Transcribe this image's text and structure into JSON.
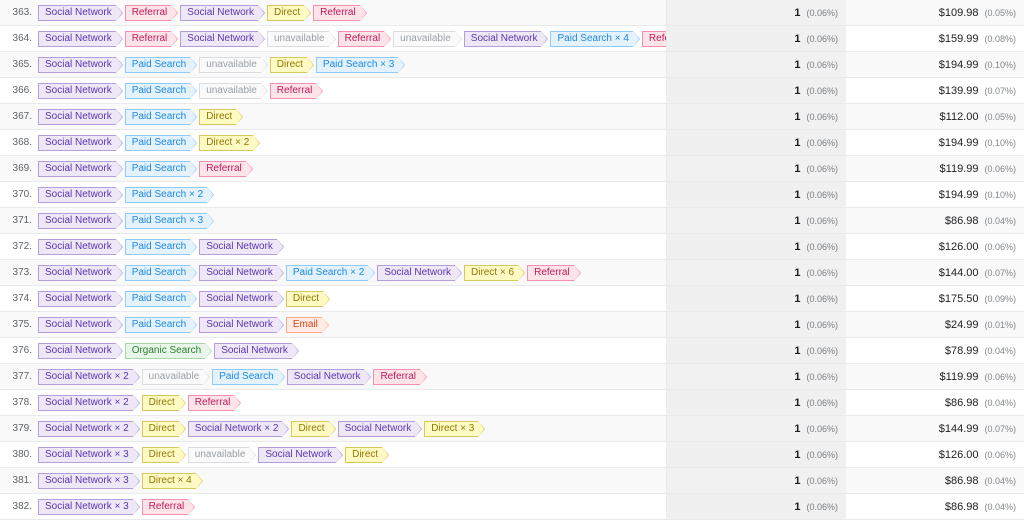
{
  "labels": {
    "social": "Social Network",
    "paid": "Paid Search",
    "direct": "Direct",
    "referral": "Referral",
    "unavail": "unavailable",
    "organic": "Organic Search",
    "email": "Email"
  },
  "count_value": "1",
  "count_pct": "(0.06%)",
  "rows": [
    {
      "idx": "363.",
      "value": "$109.98",
      "vpct": "(0.05%)",
      "path": [
        {
          "t": "social"
        },
        {
          "t": "referral"
        },
        {
          "t": "social"
        },
        {
          "t": "direct"
        },
        {
          "t": "referral"
        }
      ]
    },
    {
      "idx": "364.",
      "value": "$159.99",
      "vpct": "(0.08%)",
      "path": [
        {
          "t": "social"
        },
        {
          "t": "referral"
        },
        {
          "t": "social"
        },
        {
          "t": "unavail"
        },
        {
          "t": "referral"
        },
        {
          "t": "unavail"
        },
        {
          "t": "social"
        },
        {
          "t": "paid",
          "x": 4
        },
        {
          "t": "referral"
        }
      ]
    },
    {
      "idx": "365.",
      "value": "$194.99",
      "vpct": "(0.10%)",
      "path": [
        {
          "t": "social"
        },
        {
          "t": "paid"
        },
        {
          "t": "unavail"
        },
        {
          "t": "direct"
        },
        {
          "t": "paid",
          "x": 3
        }
      ]
    },
    {
      "idx": "366.",
      "value": "$139.99",
      "vpct": "(0.07%)",
      "path": [
        {
          "t": "social"
        },
        {
          "t": "paid"
        },
        {
          "t": "unavail"
        },
        {
          "t": "referral"
        }
      ]
    },
    {
      "idx": "367.",
      "value": "$112.00",
      "vpct": "(0.05%)",
      "path": [
        {
          "t": "social"
        },
        {
          "t": "paid"
        },
        {
          "t": "direct"
        }
      ]
    },
    {
      "idx": "368.",
      "value": "$194.99",
      "vpct": "(0.10%)",
      "path": [
        {
          "t": "social"
        },
        {
          "t": "paid"
        },
        {
          "t": "direct",
          "x": 2
        }
      ]
    },
    {
      "idx": "369.",
      "value": "$119.99",
      "vpct": "(0.06%)",
      "path": [
        {
          "t": "social"
        },
        {
          "t": "paid"
        },
        {
          "t": "referral"
        }
      ]
    },
    {
      "idx": "370.",
      "value": "$194.99",
      "vpct": "(0.10%)",
      "path": [
        {
          "t": "social"
        },
        {
          "t": "paid",
          "x": 2
        }
      ]
    },
    {
      "idx": "371.",
      "value": "$86.98",
      "vpct": "(0.04%)",
      "path": [
        {
          "t": "social"
        },
        {
          "t": "paid",
          "x": 3
        }
      ]
    },
    {
      "idx": "372.",
      "value": "$126.00",
      "vpct": "(0.06%)",
      "path": [
        {
          "t": "social"
        },
        {
          "t": "paid"
        },
        {
          "t": "social"
        }
      ]
    },
    {
      "idx": "373.",
      "value": "$144.00",
      "vpct": "(0.07%)",
      "path": [
        {
          "t": "social"
        },
        {
          "t": "paid"
        },
        {
          "t": "social"
        },
        {
          "t": "paid",
          "x": 2
        },
        {
          "t": "social"
        },
        {
          "t": "direct",
          "x": 6
        },
        {
          "t": "referral"
        }
      ]
    },
    {
      "idx": "374.",
      "value": "$175.50",
      "vpct": "(0.09%)",
      "path": [
        {
          "t": "social"
        },
        {
          "t": "paid"
        },
        {
          "t": "social"
        },
        {
          "t": "direct"
        }
      ]
    },
    {
      "idx": "375.",
      "value": "$24.99",
      "vpct": "(0.01%)",
      "path": [
        {
          "t": "social"
        },
        {
          "t": "paid"
        },
        {
          "t": "social"
        },
        {
          "t": "email"
        }
      ]
    },
    {
      "idx": "376.",
      "value": "$78.99",
      "vpct": "(0.04%)",
      "path": [
        {
          "t": "social"
        },
        {
          "t": "organic"
        },
        {
          "t": "social"
        }
      ]
    },
    {
      "idx": "377.",
      "value": "$119.99",
      "vpct": "(0.06%)",
      "path": [
        {
          "t": "social",
          "x": 2
        },
        {
          "t": "unavail"
        },
        {
          "t": "paid"
        },
        {
          "t": "social"
        },
        {
          "t": "referral"
        }
      ]
    },
    {
      "idx": "378.",
      "value": "$86.98",
      "vpct": "(0.04%)",
      "path": [
        {
          "t": "social",
          "x": 2
        },
        {
          "t": "direct"
        },
        {
          "t": "referral"
        }
      ]
    },
    {
      "idx": "379.",
      "value": "$144.99",
      "vpct": "(0.07%)",
      "path": [
        {
          "t": "social",
          "x": 2
        },
        {
          "t": "direct"
        },
        {
          "t": "social",
          "x": 2
        },
        {
          "t": "direct"
        },
        {
          "t": "social"
        },
        {
          "t": "direct",
          "x": 3
        }
      ]
    },
    {
      "idx": "380.",
      "value": "$126.00",
      "vpct": "(0.06%)",
      "path": [
        {
          "t": "social",
          "x": 3
        },
        {
          "t": "direct"
        },
        {
          "t": "unavail"
        },
        {
          "t": "social"
        },
        {
          "t": "direct"
        }
      ]
    },
    {
      "idx": "381.",
      "value": "$86.98",
      "vpct": "(0.04%)",
      "path": [
        {
          "t": "social",
          "x": 3
        },
        {
          "t": "direct",
          "x": 4
        }
      ]
    },
    {
      "idx": "382.",
      "value": "$86.98",
      "vpct": "(0.04%)",
      "path": [
        {
          "t": "social",
          "x": 3
        },
        {
          "t": "referral"
        }
      ]
    }
  ]
}
